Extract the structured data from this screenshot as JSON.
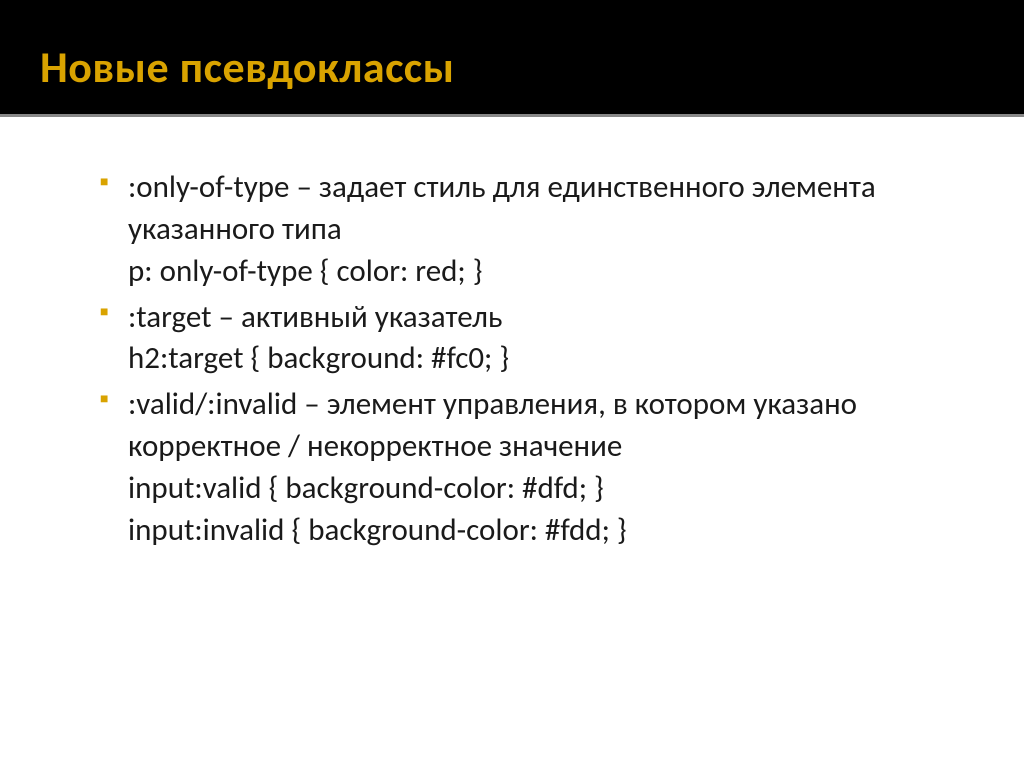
{
  "header": {
    "title": "Новые псевдоклассы"
  },
  "content": {
    "items": [
      {
        "lines": [
          ":only-of-type – задает стиль для единственного элемента указанного типа",
          "p: only-of-type { color: red; }"
        ]
      },
      {
        "lines": [
          ":target – активный указатель",
          " h2:target { background: #fc0; }"
        ]
      },
      {
        "lines": [
          ":valid/:invalid – элемент управления, в котором указано корректное / некорректное значение",
          "input:valid { background-color: #dfd; }",
          "input:invalid { background-color: #fdd; }"
        ]
      }
    ]
  }
}
